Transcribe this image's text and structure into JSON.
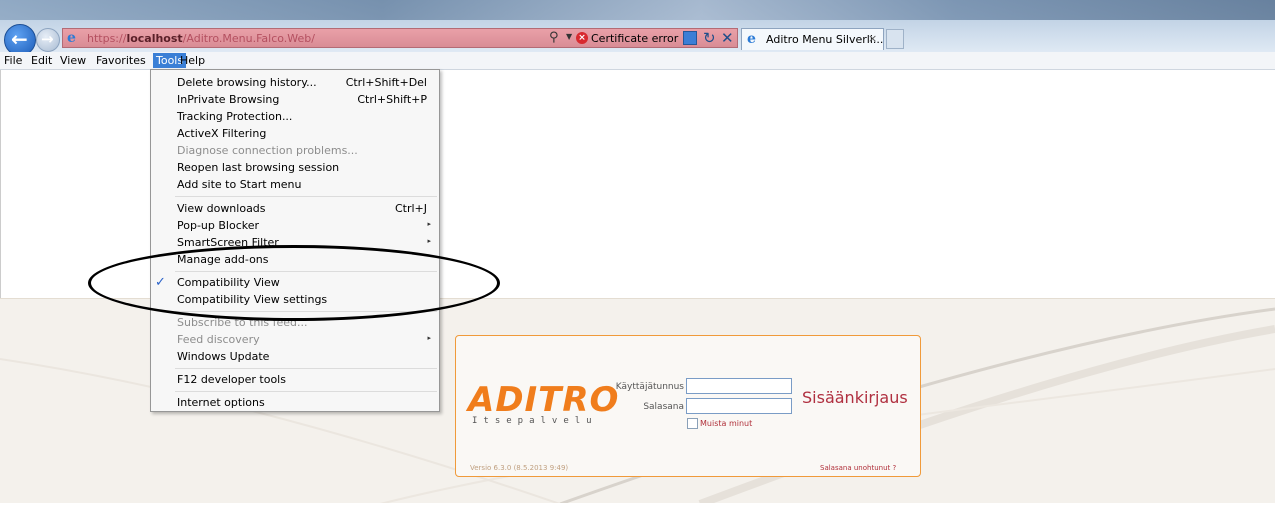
{
  "browser": {
    "url_prefix": "https://",
    "url_host": "localhost",
    "url_path": "/Aditro.Menu.Falco.Web/",
    "cert_error": "Certificate error",
    "tab_title": "Aditro Menu Silverli...",
    "tab_close": "×"
  },
  "menubar": {
    "file": "File",
    "edit": "Edit",
    "view": "View",
    "favorites": "Favorites",
    "tools": "Tools",
    "help": "Help"
  },
  "tools_menu": {
    "items": [
      {
        "label": "Delete browsing history...",
        "shortcut": "Ctrl+Shift+Del"
      },
      {
        "label": "InPrivate Browsing",
        "shortcut": "Ctrl+Shift+P"
      },
      {
        "label": "Tracking Protection...",
        "shortcut": ""
      },
      {
        "label": "ActiveX Filtering",
        "shortcut": ""
      },
      {
        "label": "Diagnose connection problems...",
        "shortcut": "",
        "disabled": true
      },
      {
        "label": "Reopen last browsing session",
        "shortcut": ""
      },
      {
        "label": "Add site to Start menu",
        "shortcut": ""
      },
      {
        "label": "View downloads",
        "shortcut": "Ctrl+J"
      },
      {
        "label": "Pop-up Blocker",
        "shortcut": "",
        "submenu": true
      },
      {
        "label": "SmartScreen Filter",
        "shortcut": "",
        "submenu": true
      },
      {
        "label": "Manage add-ons",
        "shortcut": ""
      },
      {
        "label": "Compatibility View",
        "shortcut": "",
        "checked": true
      },
      {
        "label": "Compatibility View settings",
        "shortcut": ""
      },
      {
        "label": "Subscribe to this feed...",
        "shortcut": "",
        "disabled": true
      },
      {
        "label": "Feed discovery",
        "shortcut": "",
        "disabled": true,
        "submenu": true
      },
      {
        "label": "Windows Update",
        "shortcut": ""
      },
      {
        "label": "F12 developer tools",
        "shortcut": ""
      },
      {
        "label": "Internet options",
        "shortcut": ""
      }
    ],
    "check_mark": "✓",
    "submenu_arrow": "▸"
  },
  "login": {
    "logo_text": "ADITRO",
    "logo_subtitle": "Itsepalvelu",
    "username_label": "Käyttäjätunnus",
    "password_label": "Salasana",
    "username_value": "",
    "password_value": "",
    "remember_label": "Muista minut",
    "remember_checked": false,
    "title": "Sisäänkirjaus",
    "version": "Versio 6.3.0 (8.5.2013 9:49)",
    "forgot_link": "Salasana unohtunut ?"
  },
  "colors": {
    "accent_orange": "#f07d1c",
    "login_red": "#b03040",
    "address_error_bg": "#d98c95",
    "menu_highlight": "#3a7fd6"
  }
}
